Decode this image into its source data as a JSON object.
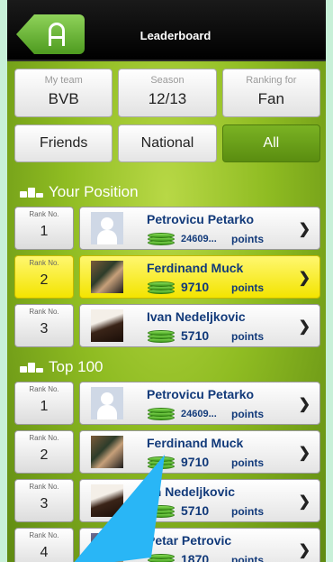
{
  "header": {
    "title": "Leaderboard"
  },
  "filters": [
    {
      "label": "My team",
      "value": "BVB"
    },
    {
      "label": "Season",
      "value": "12/13"
    },
    {
      "label": "Ranking for",
      "value": "Fan"
    }
  ],
  "tabs": [
    {
      "label": "Friends",
      "active": false
    },
    {
      "label": "National",
      "active": false
    },
    {
      "label": "All",
      "active": true
    }
  ],
  "sections": {
    "your_position": "Your Position",
    "top100": "Top 100"
  },
  "rank_label": "Rank No.",
  "points_label": "points",
  "your_position_rows": [
    {
      "rank": "1",
      "name": "Petrovicu Petarko",
      "points": "24609...",
      "highlight": false
    },
    {
      "rank": "2",
      "name": "Ferdinand Muck",
      "points": "9710",
      "highlight": true
    },
    {
      "rank": "3",
      "name": "Ivan Nedeljkovic",
      "points": "5710",
      "highlight": false
    }
  ],
  "top100_rows": [
    {
      "rank": "1",
      "name": "Petrovicu Petarko",
      "points": "24609..."
    },
    {
      "rank": "2",
      "name": "Ferdinand Muck",
      "points": "9710"
    },
    {
      "rank": "3",
      "name": "an Nedeljkovic",
      "points": "5710"
    },
    {
      "rank": "4",
      "name": "Petar Petrovic",
      "points": "1870"
    }
  ],
  "colors": {
    "accent": "#8fbc22",
    "highlight": "#f3e400",
    "name_text": "#123a7a"
  }
}
